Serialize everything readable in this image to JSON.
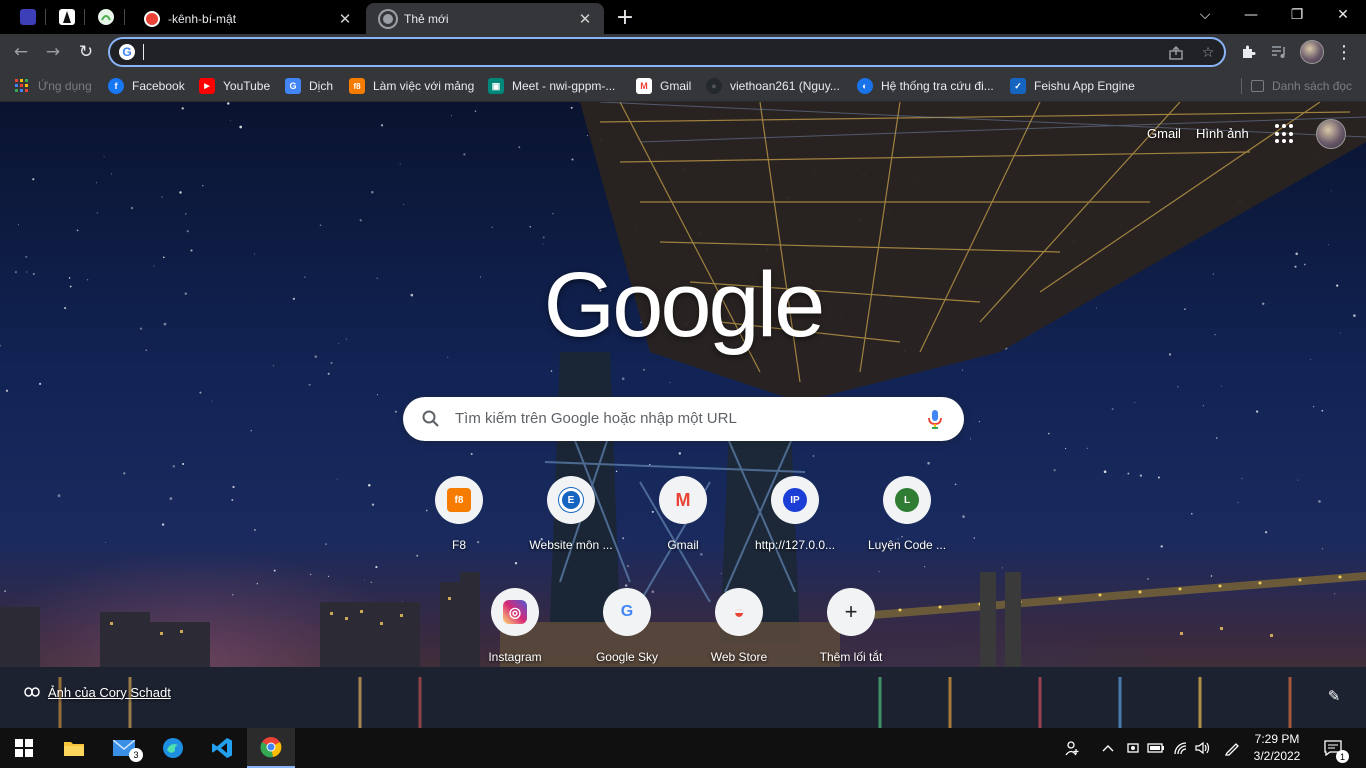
{
  "tabs": {
    "active_tab_label": "Kênh-bí-mật tab",
    "tab1_title": "-kênh-bí-mật",
    "tab2_title": "Thẻ mới",
    "close_glyph": "✕",
    "new_tab_glyph": "+"
  },
  "window_controls": {
    "dropdown": "⌵",
    "minimize": "—",
    "restore": "❐",
    "close": "✕"
  },
  "toolbar": {
    "back": "←",
    "forward": "→",
    "reload": "↻",
    "omnibox_value": "",
    "g_chip": "G"
  },
  "bookmarks": {
    "apps_label": "Ứng dụng",
    "items": [
      {
        "label": "Facebook",
        "color": "#1877f2",
        "glyph": "f"
      },
      {
        "label": "YouTube",
        "color": "#ff0000",
        "glyph": "▶"
      },
      {
        "label": "Dịch",
        "color": "#4285f4",
        "glyph": "G"
      },
      {
        "label": "Làm việc với mảng",
        "color": "#f57c00",
        "glyph": "f8"
      },
      {
        "label": "Meet - nwi-gppm-...",
        "color": "#00897b",
        "glyph": "▣"
      },
      {
        "label": "Gmail",
        "color": "#ea4335",
        "glyph": "M"
      },
      {
        "label": "viethoan261 (Nguy...",
        "color": "#24292e",
        "glyph": "●"
      },
      {
        "label": "Hệ thống tra cứu đi...",
        "color": "#1a73e8",
        "glyph": "◐"
      },
      {
        "label": "Feishu App Engine",
        "color": "#1565c0",
        "glyph": "✓"
      }
    ],
    "reading_list": "Danh sách đọc"
  },
  "ntp": {
    "gmail_link": "Gmail",
    "images_link": "Hình ảnh",
    "logo": "Google",
    "search_placeholder": "Tìm kiếm trên Google hoặc nhập một URL",
    "shortcuts": [
      {
        "label": "F8",
        "color": "#f57c00",
        "glyph": "f8"
      },
      {
        "label": "Website môn ...",
        "color": "#1565c0",
        "glyph": "E"
      },
      {
        "label": "Gmail",
        "color": "#ffffff",
        "glyph": "M"
      },
      {
        "label": "http://127.0.0...",
        "color": "#1a3ed6",
        "glyph": "IP"
      },
      {
        "label": "Luyện Code ...",
        "color": "#2e7d32",
        "glyph": "L"
      },
      {
        "label": "Instagram",
        "color": "#d6249f",
        "glyph": "◎"
      },
      {
        "label": "Google Sky",
        "color": "#ffffff",
        "glyph": "G"
      },
      {
        "label": "Web Store",
        "color": "#ffffff",
        "glyph": "◒"
      },
      {
        "label": "Thêm lối tắt",
        "color": "#f1f3f4",
        "glyph": "+"
      }
    ],
    "attribution": "Ảnh của Cory Schadt",
    "customize_glyph": "✎"
  },
  "taskbar": {
    "mail_badge": "3",
    "clock_time": "7:29 PM",
    "clock_date": "3/2/2022",
    "notif_badge": "1"
  }
}
